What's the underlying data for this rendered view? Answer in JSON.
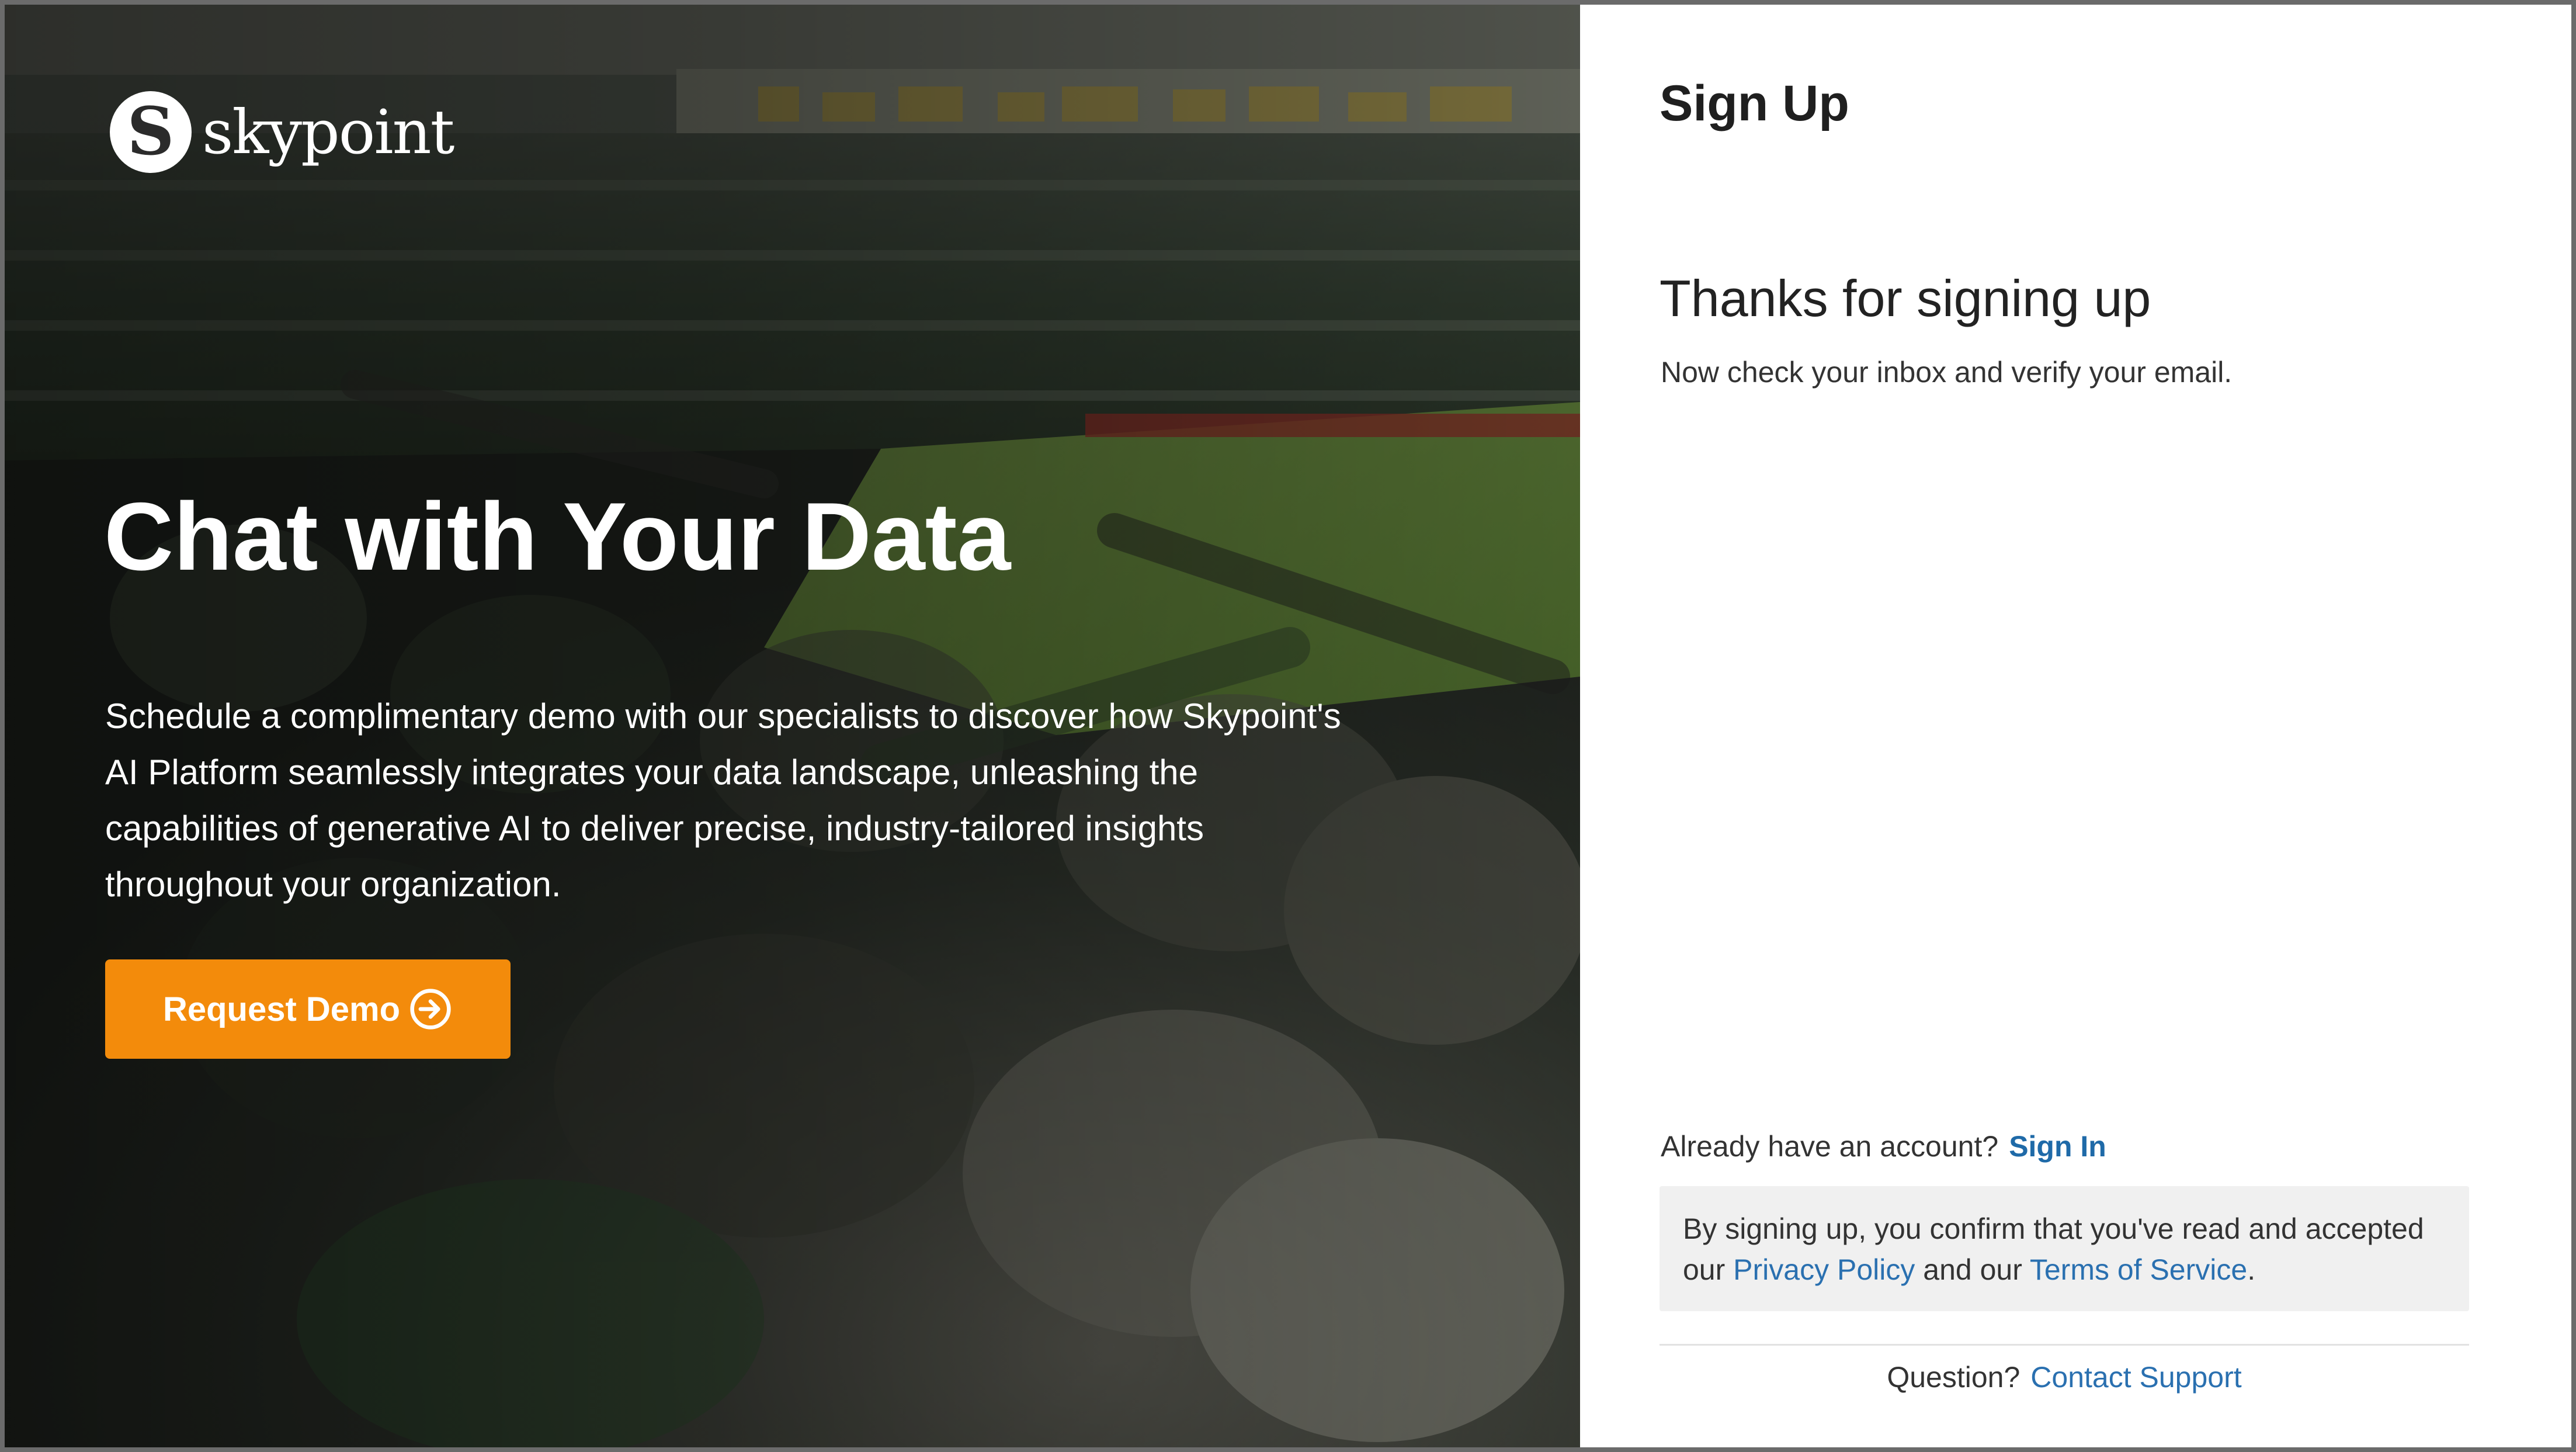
{
  "brand": {
    "logo_letter": "S",
    "logo_text": "skypoint"
  },
  "hero": {
    "title": "Chat with Your Data",
    "description": "Schedule a complimentary demo with our specialists to discover how Skypoint's AI Platform seamlessly integrates your data landscape, unleashing the capabilities of generative AI to deliver precise, industry-tailored insights throughout your organization.",
    "cta_label": "Request Demo",
    "cta_icon": "arrow-circle-right-icon",
    "background": "stadium-crowd-photo"
  },
  "signup": {
    "title": "Sign Up",
    "thanks_title": "Thanks for signing up",
    "thanks_message": "Now check your inbox and verify your email.",
    "already_text": "Already have an account?",
    "sign_in_link": "Sign In",
    "consent_prefix": "By signing up, you confirm that you've read and accepted our",
    "privacy_link": "Privacy Policy",
    "consent_middle": "and our",
    "terms_link": "Terms of Service",
    "consent_suffix": ".",
    "question_text": "Question?",
    "support_link": "Contact Support"
  },
  "colors": {
    "accent_orange": "#f38b0b",
    "link_blue": "#2a70b0",
    "consent_bg": "#f0f0f0"
  }
}
